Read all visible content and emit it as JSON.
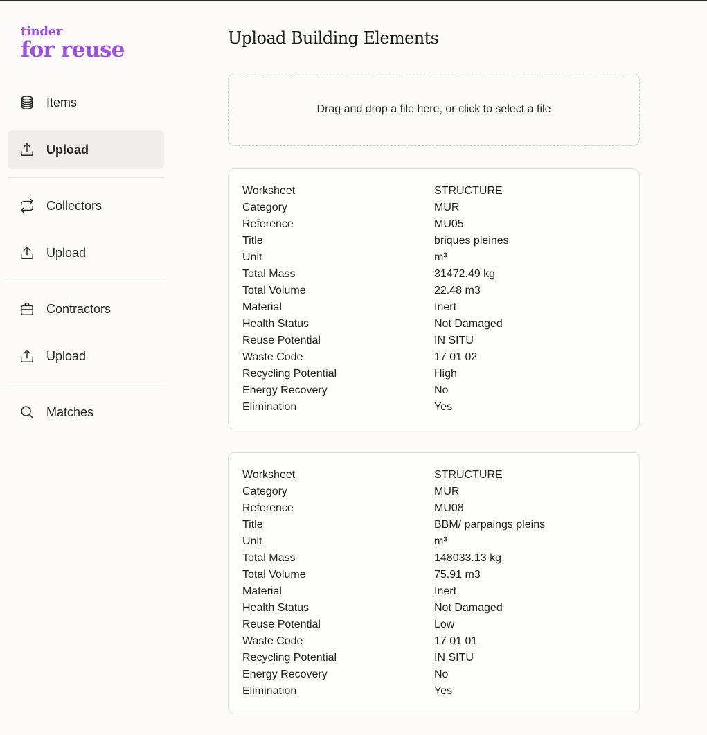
{
  "brand": {
    "line1": "tinder",
    "line2": "for reuse"
  },
  "nav": {
    "items_label": "Items",
    "items_upload_label": "Upload",
    "collectors_label": "Collectors",
    "collectors_upload_label": "Upload",
    "contractors_label": "Contractors",
    "contractors_upload_label": "Upload",
    "matches_label": "Matches",
    "active": "items_upload"
  },
  "main": {
    "title": "Upload Building Elements",
    "dropzone_text": "Drag and drop a file here, or click to select a file"
  },
  "records": [
    {
      "fields": [
        {
          "key": "Worksheet",
          "value": "STRUCTURE"
        },
        {
          "key": "Category",
          "value": "MUR"
        },
        {
          "key": "Reference",
          "value": "MU05"
        },
        {
          "key": "Title",
          "value": "briques pleines"
        },
        {
          "key": "Unit",
          "value": "m³"
        },
        {
          "key": "Total Mass",
          "value": "31472.49 kg"
        },
        {
          "key": "Total Volume",
          "value": "22.48 m3"
        },
        {
          "key": "Material",
          "value": "Inert"
        },
        {
          "key": "Health Status",
          "value": "Not Damaged"
        },
        {
          "key": "Reuse Potential",
          "value": "IN SITU"
        },
        {
          "key": "Waste Code",
          "value": "17 01 02"
        },
        {
          "key": "Recycling Potential",
          "value": "High"
        },
        {
          "key": "Energy Recovery",
          "value": "No"
        },
        {
          "key": "Elimination",
          "value": "Yes"
        }
      ]
    },
    {
      "fields": [
        {
          "key": "Worksheet",
          "value": "STRUCTURE"
        },
        {
          "key": "Category",
          "value": "MUR"
        },
        {
          "key": "Reference",
          "value": "MU08"
        },
        {
          "key": "Title",
          "value": "BBM/ parpaings pleins"
        },
        {
          "key": "Unit",
          "value": "m³"
        },
        {
          "key": "Total Mass",
          "value": "148033.13 kg"
        },
        {
          "key": "Total Volume",
          "value": "75.91 m3"
        },
        {
          "key": "Material",
          "value": "Inert"
        },
        {
          "key": "Health Status",
          "value": "Not Damaged"
        },
        {
          "key": "Reuse Potential",
          "value": "Low"
        },
        {
          "key": "Waste Code",
          "value": "17 01 01"
        },
        {
          "key": "Recycling Potential",
          "value": "IN SITU"
        },
        {
          "key": "Energy Recovery",
          "value": "No"
        },
        {
          "key": "Elimination",
          "value": "Yes"
        }
      ]
    }
  ],
  "colors": {
    "brand": "#9b51e0",
    "background": "#fcfbf9",
    "active_nav": "#efeeec"
  }
}
